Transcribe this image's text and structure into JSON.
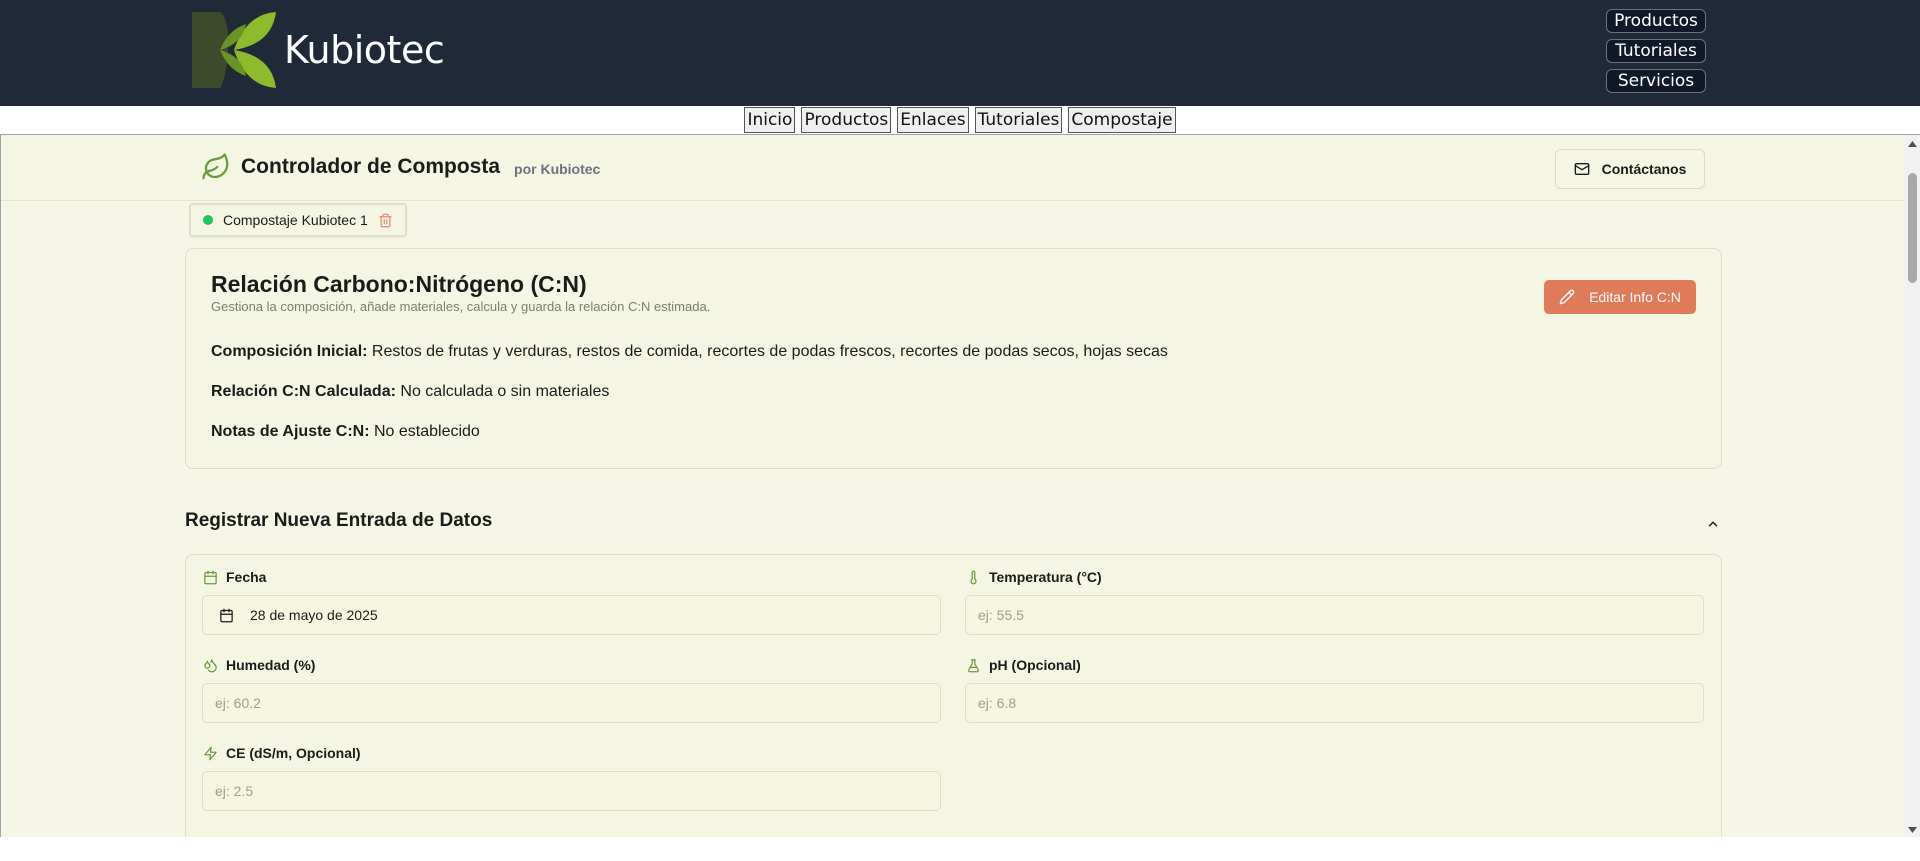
{
  "site": {
    "brand": "Kubiotec",
    "nav": [
      "Productos",
      "Tutoriales",
      "Servicios"
    ],
    "colors": {
      "header_bg": "#1f2937",
      "leaf_dark": "#3e4a2c",
      "leaf_light": "#8dbb2c"
    }
  },
  "subnav": [
    "Inicio",
    "Productos",
    "Enlaces",
    "Tutoriales",
    "Compostaje"
  ],
  "app": {
    "title": "Controlador de Composta",
    "subtitle": "por Kubiotec",
    "contact_label": "Contáctanos",
    "tab": {
      "label": "Compostaje Kubiotec 1",
      "status_color": "#22c55e"
    },
    "cn_card": {
      "title": "Relación Carbono:Nitrógeno (C:N)",
      "description": "Gestiona la composición, añade materiales, calcula y guarda la relación C:N estimada.",
      "edit_label": "Editar Info C:N",
      "rows": [
        {
          "label": "Composición Inicial:",
          "value": "Restos de frutas y verduras, restos de comida, recortes de podas frescos, recortes de podas secos, hojas secas"
        },
        {
          "label": "Relación C:N Calculada:",
          "value": "No calculada o sin materiales"
        },
        {
          "label": "Notas de Ajuste C:N:",
          "value": "No establecido"
        }
      ]
    },
    "form": {
      "section_title": "Registrar Nueva Entrada de Datos",
      "fields": {
        "date": {
          "label": "Fecha",
          "value": "28 de mayo de 2025",
          "icon": "calendar-icon"
        },
        "temperature": {
          "label": "Temperatura (°C)",
          "placeholder": "ej: 55.5",
          "icon": "thermometer-icon"
        },
        "humidity": {
          "label": "Humedad (%)",
          "placeholder": "ej: 60.2",
          "icon": "droplets-icon"
        },
        "ph": {
          "label": "pH (Opcional)",
          "placeholder": "ej: 6.8",
          "icon": "flask-icon"
        },
        "ce": {
          "label": "CE (dS/m, Opcional)",
          "placeholder": "ej: 2.5",
          "icon": "zap-icon"
        }
      }
    }
  }
}
